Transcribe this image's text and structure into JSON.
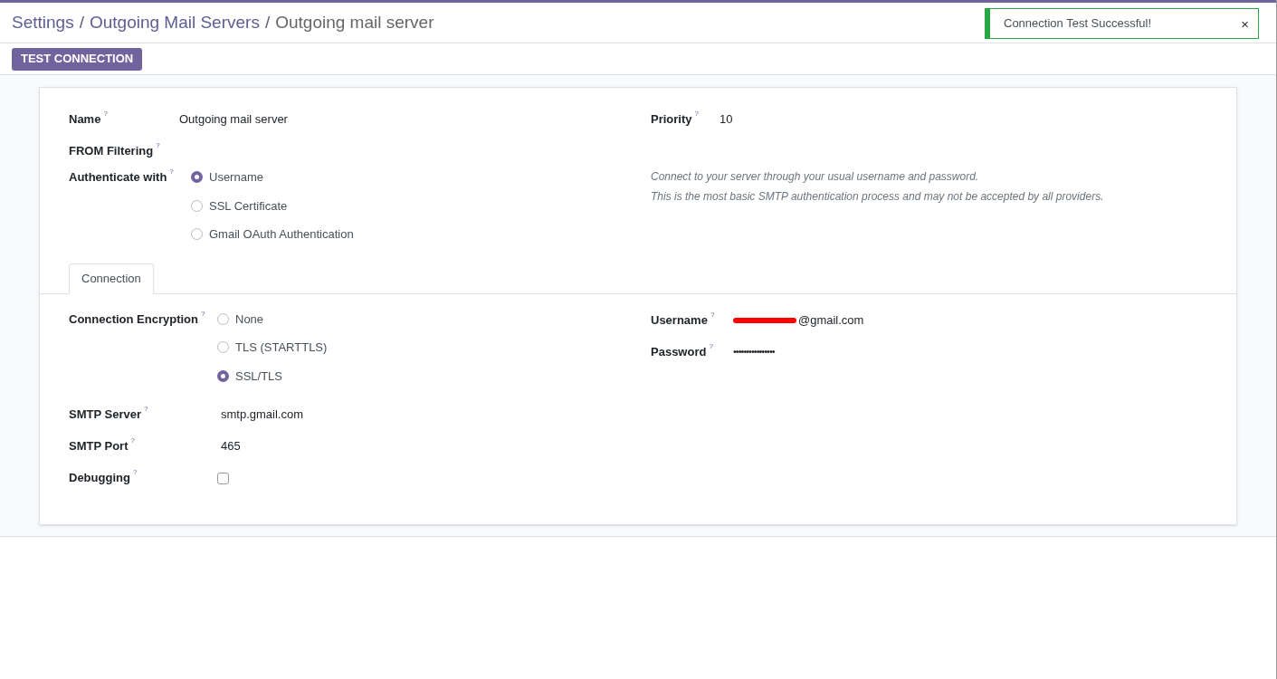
{
  "breadcrumb": {
    "separator": "/",
    "items": [
      {
        "label": "Settings"
      },
      {
        "label": "Outgoing Mail Servers"
      },
      {
        "label": "Outgoing mail server"
      }
    ]
  },
  "toast": {
    "message": "Connection Test Successful!",
    "close": "×"
  },
  "action_button": "TEST CONNECTION",
  "form": {
    "name": {
      "label": "Name",
      "help": "?",
      "value": "Outgoing mail server"
    },
    "priority": {
      "label": "Priority",
      "help": "?",
      "value": "10"
    },
    "from_filtering": {
      "label": "FROM Filtering",
      "help": "?"
    },
    "authenticate": {
      "label": "Authenticate with",
      "help": "?",
      "options": [
        {
          "label": "Username",
          "selected": true
        },
        {
          "label": "SSL Certificate",
          "selected": false
        },
        {
          "label": "Gmail OAuth Authentication",
          "selected": false
        }
      ]
    },
    "auth_hint": [
      "Connect to your server through your usual username and password.",
      "This is the most basic SMTP authentication process and may not be accepted by all providers."
    ]
  },
  "tabs": [
    {
      "label": "Connection",
      "selected": true
    }
  ],
  "connection": {
    "encryption": {
      "label": "Connection Encryption",
      "help": "?",
      "options": [
        {
          "label": "None",
          "selected": false
        },
        {
          "label": "TLS (STARTTLS)",
          "selected": false
        },
        {
          "label": "SSL/TLS",
          "selected": true
        }
      ]
    },
    "smtp_server": {
      "label": "SMTP Server",
      "help": "?",
      "value": "smtp.gmail.com"
    },
    "smtp_port": {
      "label": "SMTP Port",
      "help": "?",
      "value": "465"
    },
    "debugging": {
      "label": "Debugging",
      "help": "?",
      "checked": false
    },
    "username": {
      "label": "Username",
      "help": "?",
      "value": "@gmail.com",
      "redacted": true
    },
    "password": {
      "label": "Password",
      "help": "?",
      "value": "••••••••••••••••"
    }
  }
}
